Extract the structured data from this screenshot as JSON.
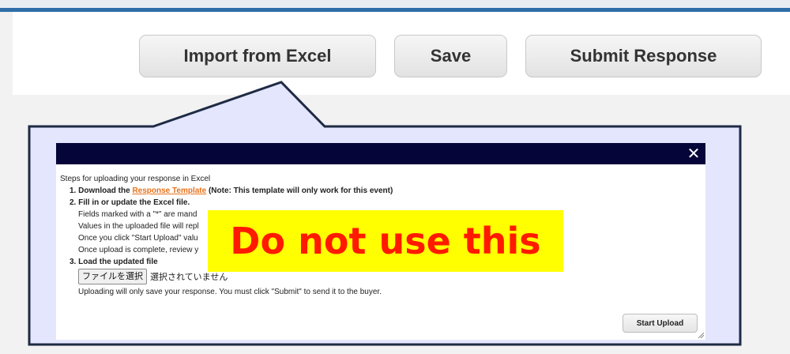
{
  "toolbar": {
    "import_label": "Import from Excel",
    "save_label": "Save",
    "submit_label": "Submit Response"
  },
  "modal": {
    "close_glyph": "✕",
    "intro": "Steps for uploading your response in Excel",
    "step1_prefix": "1. Download the ",
    "step1_link": "Response Template",
    "step1_note": " (Note: This template will only work for this event)",
    "step2_title": "2. Fill in or update the Excel file.",
    "step2_lines": [
      "Fields marked with a \"*\" are mand",
      "Values in the uploaded file will repl",
      "Once you click \"Start Upload\" valu",
      "Once upload is complete, review y"
    ],
    "step3_title": "3. Load the updated file",
    "file_button": "ファイルを選択",
    "file_status": "選択されていません",
    "upload_note": "Uploading will only save your response. You must click \"Submit\" to send it to the buyer.",
    "start_upload": "Start Upload"
  },
  "overlay": {
    "warning_text": "Do not use this",
    "warning_bg": "#ffff00",
    "warning_color": "#ff1a00"
  },
  "colors": {
    "accent_bar": "#2f6ea8",
    "callout_fill": "#e3e6fc",
    "callout_border": "#1f2a44",
    "modal_header": "#05053a",
    "link": "#e8711b"
  }
}
